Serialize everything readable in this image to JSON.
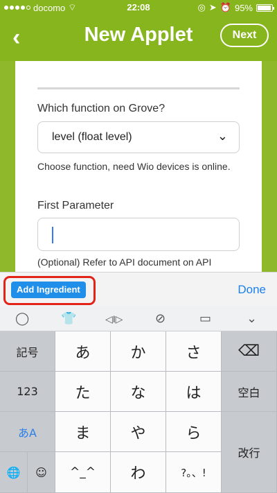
{
  "status": {
    "carrier": "docomo",
    "time": "22:08",
    "battery": "95%"
  },
  "header": {
    "back": "‹",
    "title": "New Applet",
    "next": "Next"
  },
  "form": {
    "question": "Which function on Grove?",
    "selected": "level (float level)",
    "help": "Choose function, need Wio devices is online.",
    "param_label": "First Parameter",
    "param_value": "",
    "optional_note": "(Optional) Refer to API document on API"
  },
  "accessory": {
    "ingredient": "Add Ingredient",
    "done": "Done"
  },
  "emoji_bar": [
    "◯",
    "👕",
    "◁I▷",
    "⊘",
    "▭",
    "⌄"
  ],
  "keyboard": {
    "left": [
      "記号",
      "123",
      "あA",
      "🌐"
    ],
    "smile": "☺",
    "rows": [
      [
        "あ",
        "か",
        "さ"
      ],
      [
        "た",
        "な",
        "は"
      ],
      [
        "ま",
        "や",
        "ら"
      ],
      [
        "^_^",
        "わ",
        "?。、!"
      ]
    ],
    "delete": "⌫",
    "space": "空白",
    "enter": "改行"
  },
  "colors": {
    "brand_green": "#87b51e",
    "ingredient_blue": "#1f8fea",
    "highlight_red": "#e32218",
    "done_blue": "#1a7ff0"
  }
}
